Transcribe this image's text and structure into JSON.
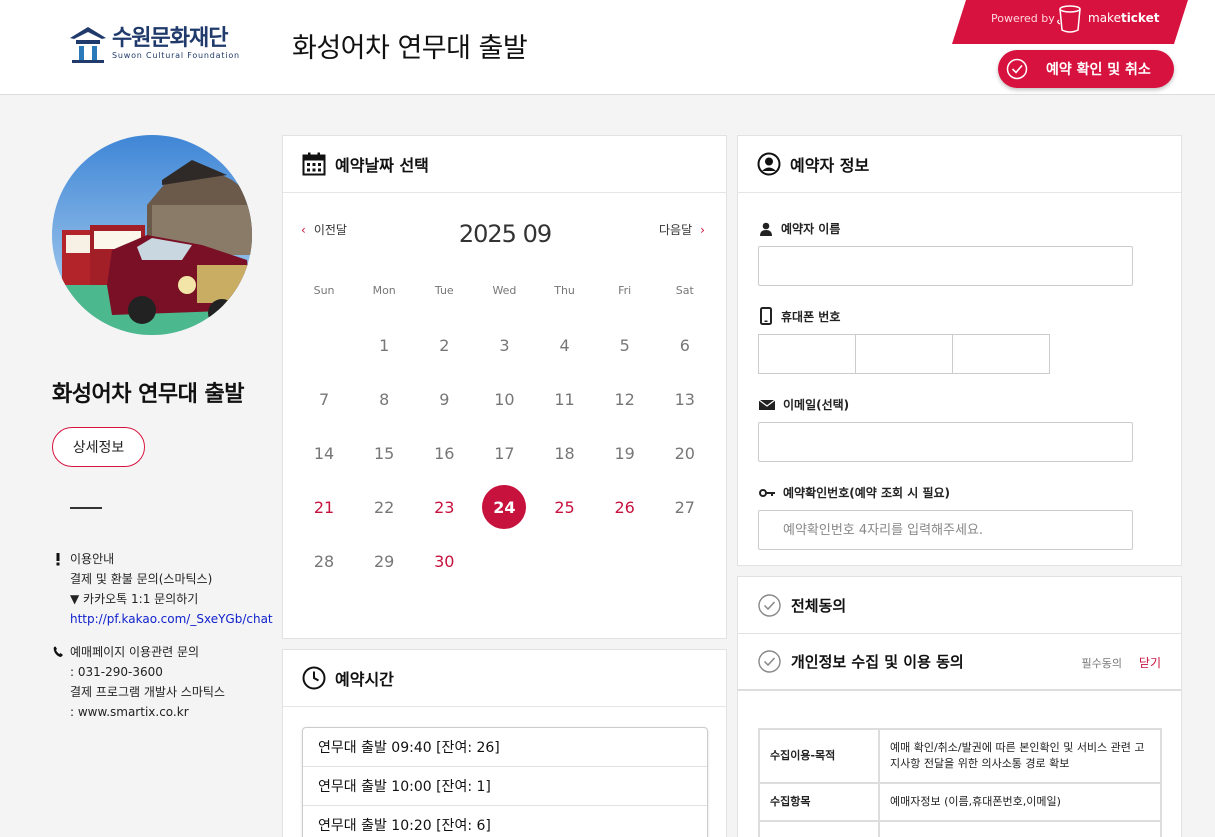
{
  "header": {
    "logo_ko": "수원문화재단",
    "logo_en": "Suwon Cultural Foundation",
    "title": "화성어차 연무대 출발",
    "powered_label": "Powered by",
    "brand_light": "make",
    "brand_bold": "ticket",
    "confirm_button": "예약 확인 및 취소"
  },
  "left": {
    "product_name": "화성어차 연무대 출발",
    "detail_button": "상세정보",
    "usage": {
      "line1": "이용안내",
      "line2": "결제 및 환불 문의(스마틱스)",
      "line3": "▼ 카카오톡 1:1 문의하기",
      "link": "http://pf.kakao.com/_SxeYGb/chat"
    },
    "contact": {
      "line1": "예매페이지 이용관련 문의",
      "line2": ": 031-290-3600",
      "line3": "결제 프로그램 개발사 스마틱스",
      "line4": ": www.smartix.co.kr"
    }
  },
  "calendar": {
    "title": "예약날짜 선택",
    "prev": "이전달",
    "next": "다음달",
    "month": "2025 09",
    "weekdays": [
      "Sun",
      "Mon",
      "Tue",
      "Wed",
      "Thu",
      "Fri",
      "Sat"
    ],
    "days": [
      "",
      "1",
      "2",
      "3",
      "4",
      "5",
      "6",
      "7",
      "8",
      "9",
      "10",
      "11",
      "12",
      "13",
      "14",
      "15",
      "16",
      "17",
      "18",
      "19",
      "20",
      "21",
      "22",
      "23",
      "24",
      "25",
      "26",
      "27",
      "28",
      "29",
      "30",
      "",
      "",
      "",
      ""
    ],
    "holidays": [
      "21",
      "23",
      "25",
      "26",
      "30"
    ],
    "selected": "24"
  },
  "time": {
    "title": "예약시간",
    "slots": [
      "연무대 출발 09:40 [잔여: 26]",
      "연무대 출발 10:00 [잔여: 1]",
      "연무대 출발 10:20 [잔여: 6]"
    ]
  },
  "booker": {
    "title": "예약자 정보",
    "name_label": "예약자 이름",
    "phone_label": "휴대폰 번호",
    "email_label": "이메일(선택)",
    "code_label": "예약확인번호(예약 조회 시 필요)",
    "code_placeholder": "예약확인번호 4자리를 입력해주세요."
  },
  "agreement": {
    "all": "전체동의",
    "privacy": "개인정보 수집 및 이용 동의",
    "required": "필수동의",
    "close": "닫기",
    "rows": [
      {
        "key": "수집이용-목적",
        "value": "예매 확인/취소/발권에 따른 본인확인 및 서비스 관련 고지사항 전달을 위한 의사소통 경로 확보"
      },
      {
        "key": "수집항목",
        "value": "예매자정보 (이름,휴대폰번호,이메일)"
      }
    ]
  },
  "colors": {
    "accent": "#d8123e",
    "logo": "#1f3a6b"
  }
}
